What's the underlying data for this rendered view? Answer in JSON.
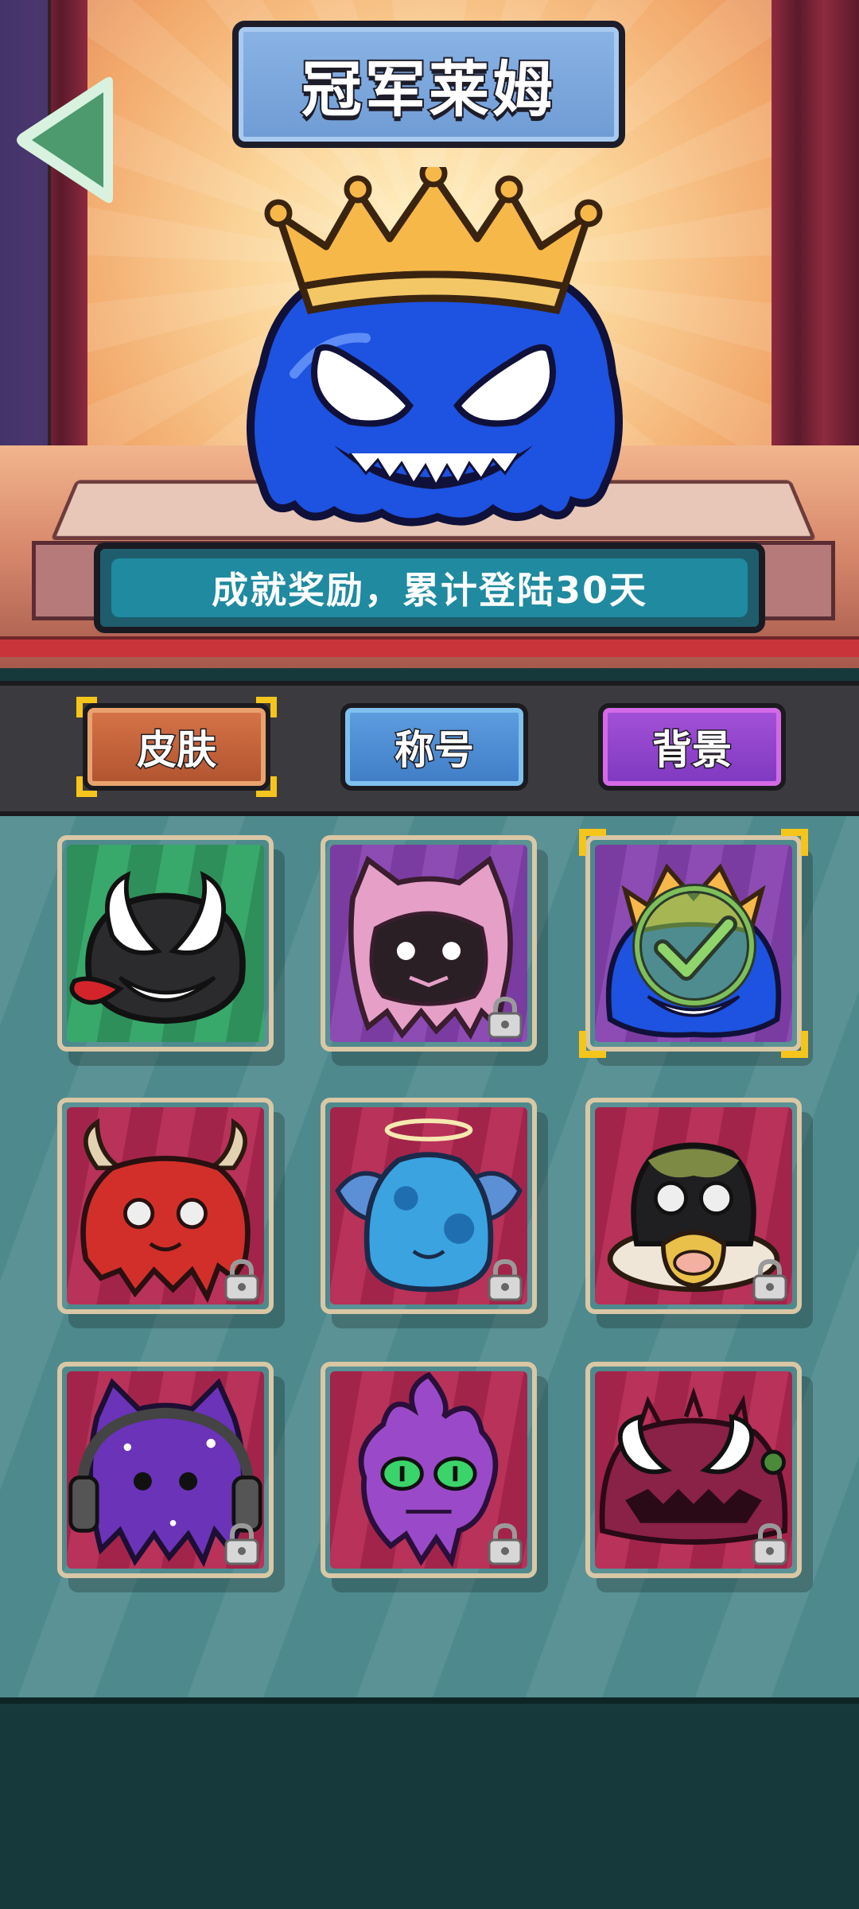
{
  "header": {
    "title": "冠军莱姆",
    "description": "成就奖励，累计登陆30天"
  },
  "tabs": [
    {
      "label": "皮肤",
      "selected": true
    },
    {
      "label": "称号",
      "selected": false
    },
    {
      "label": "背景",
      "selected": false
    }
  ],
  "skins": [
    {
      "name": "venom-black-slime",
      "locked": false,
      "selected": false
    },
    {
      "name": "pink-cat-slime",
      "locked": true,
      "selected": false
    },
    {
      "name": "crowned-blue-slime",
      "locked": false,
      "selected": true
    },
    {
      "name": "red-devil-slime",
      "locked": true,
      "selected": false
    },
    {
      "name": "angel-blue-slime",
      "locked": true,
      "selected": false
    },
    {
      "name": "cow-float-slime",
      "locked": true,
      "selected": false
    },
    {
      "name": "galaxy-headphone-slime",
      "locked": true,
      "selected": false
    },
    {
      "name": "purple-skull-slime",
      "locked": true,
      "selected": false
    },
    {
      "name": "spiky-monster-slime",
      "locked": true,
      "selected": false
    }
  ],
  "colors": {
    "accent_gold": "#f6c51b",
    "skin_tab": "#c8633a",
    "title_tab": "#4f8dd6",
    "background_tab": "#9347cf",
    "panel_teal": "#4e8a8d"
  },
  "icons": [
    "back-arrow-icon",
    "lock-icon",
    "check-icon",
    "crown-icon"
  ]
}
